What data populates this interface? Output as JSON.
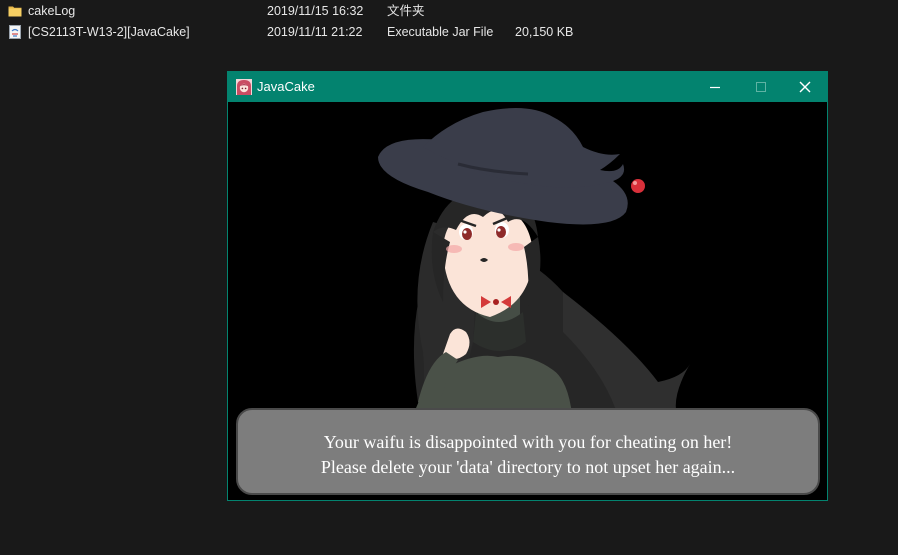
{
  "explorer": {
    "files": [
      {
        "name": "cakeLog",
        "date": "2019/11/15 16:32",
        "type": "文件夹",
        "size": "",
        "icon": "folder-icon"
      },
      {
        "name": "[CS2113T-W13-2][JavaCake]",
        "date": "2019/11/11 21:22",
        "type": "Executable Jar File",
        "size": "20,150 KB",
        "icon": "jar-file-icon"
      }
    ]
  },
  "window": {
    "title": "JavaCake",
    "icon": "app-avatar-icon",
    "accent_color": "#03836f",
    "controls": {
      "minimize": "minimize-icon",
      "maximize": "maximize-icon",
      "close": "close-icon"
    }
  },
  "dialog": {
    "line1": "Your waifu is disappointed with you for cheating on her!",
    "line2": "Please delete your 'data' directory to not upset her again..."
  }
}
